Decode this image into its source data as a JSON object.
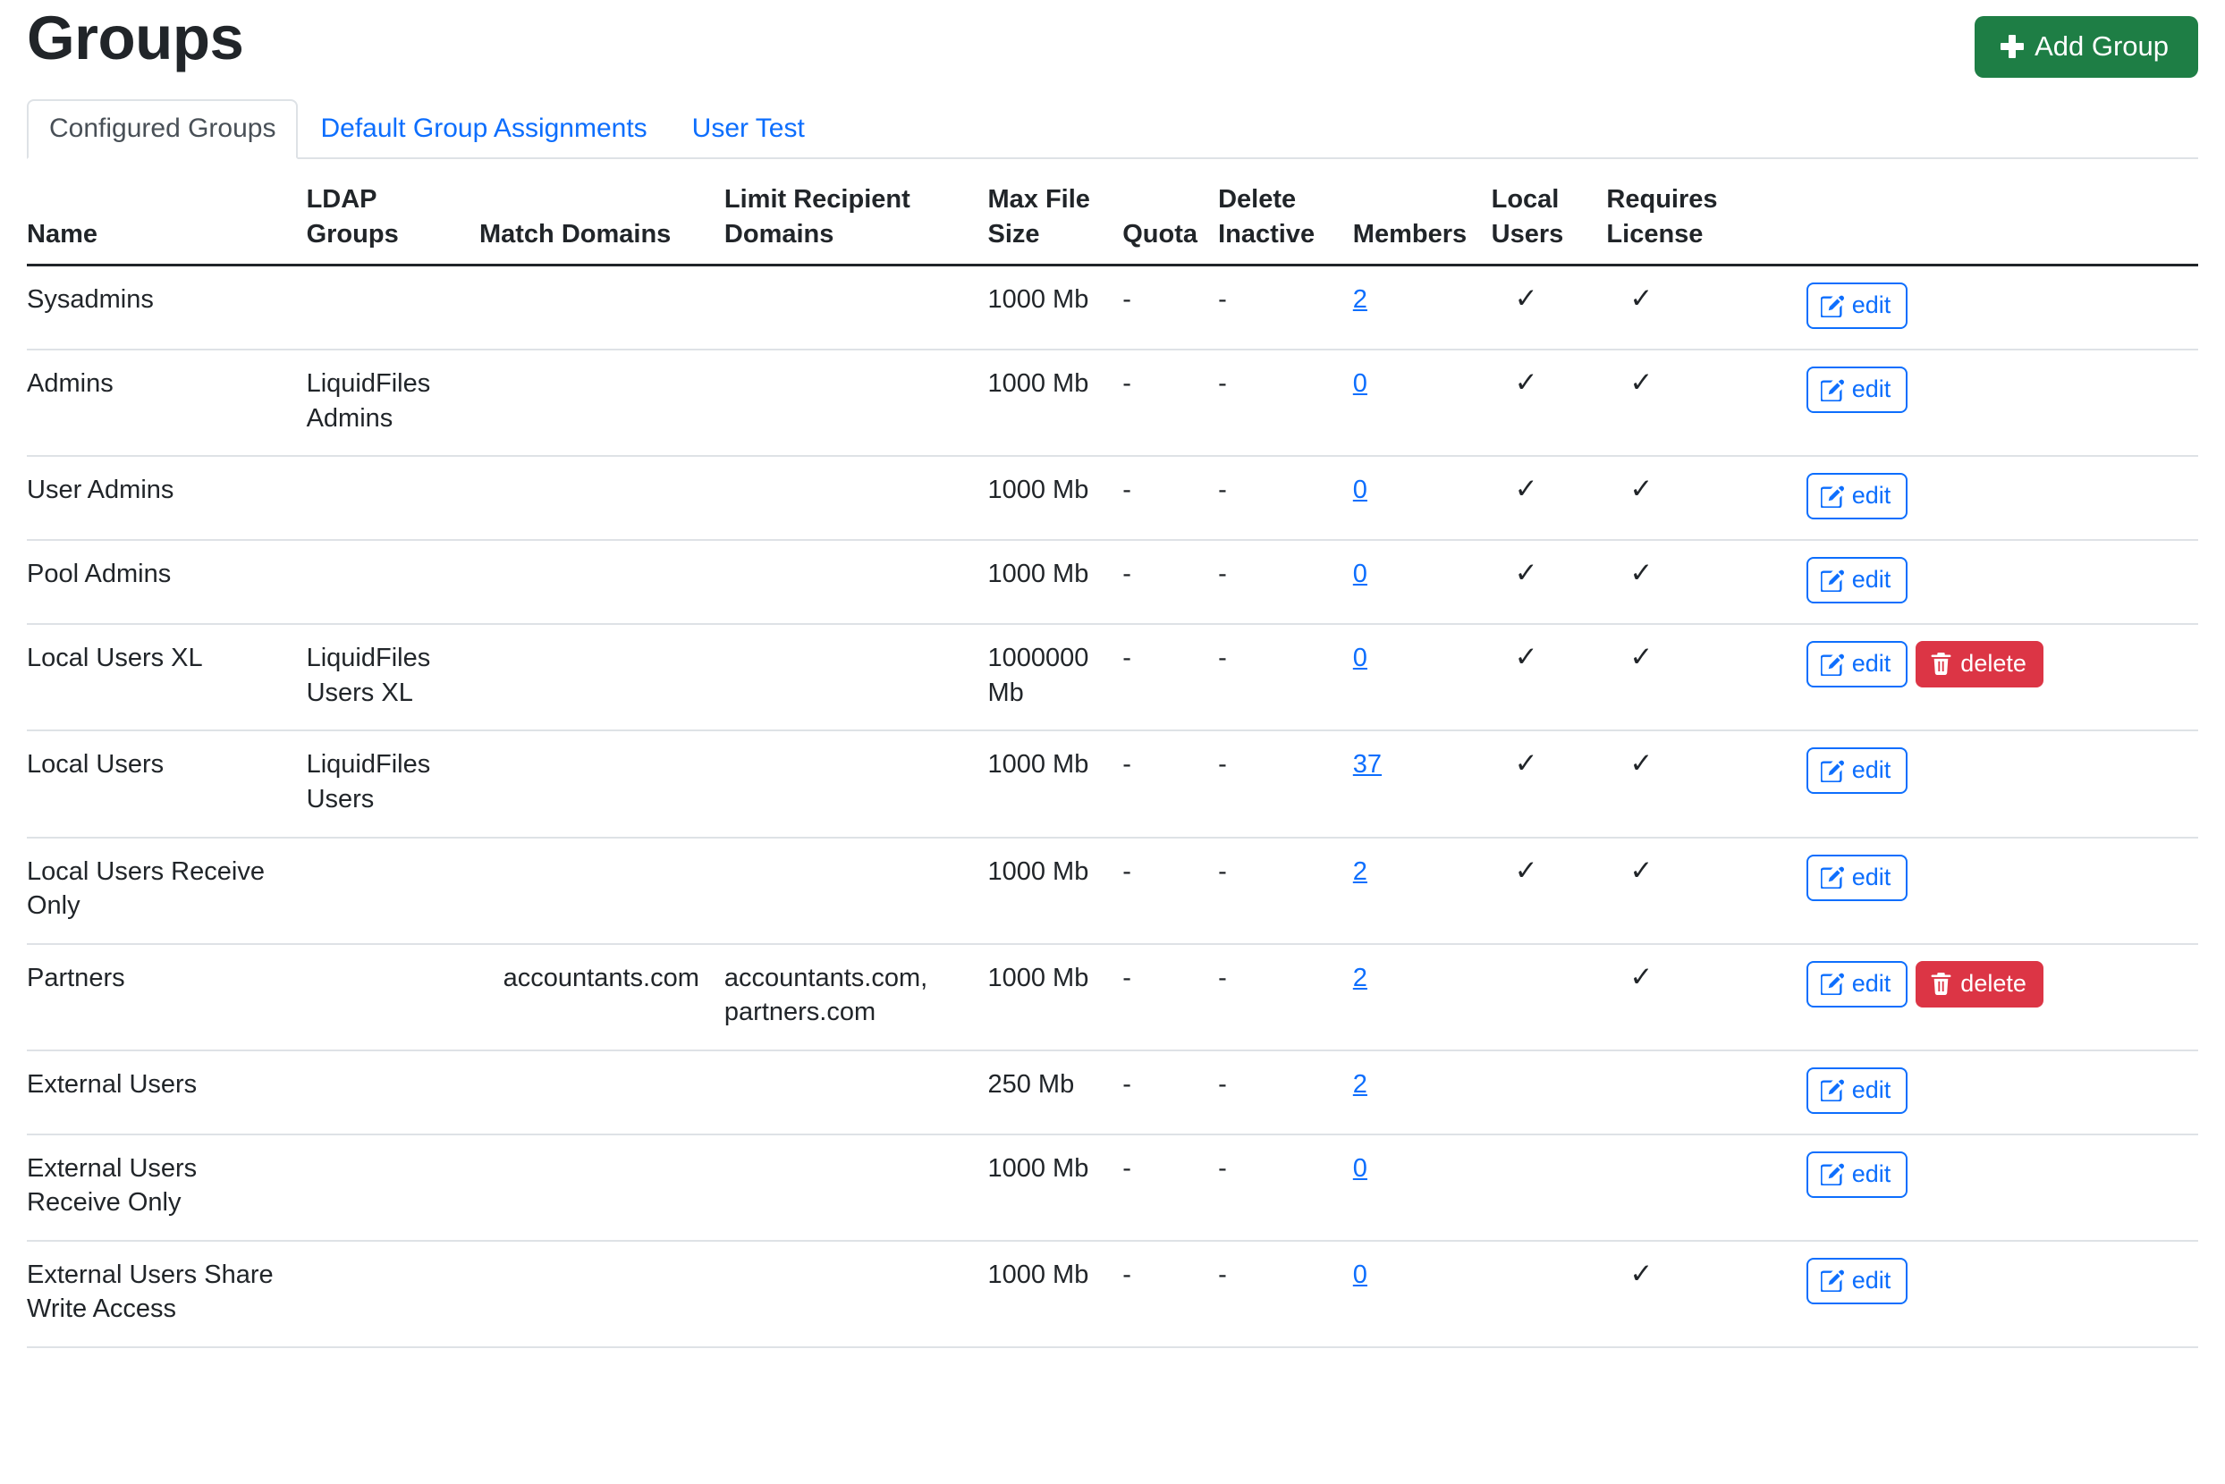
{
  "header": {
    "title": "Groups",
    "add_button": {
      "label": "Add Group",
      "icon": "plus-icon",
      "color": "#1e7e45"
    }
  },
  "tabs": [
    {
      "label": "Configured Groups",
      "active": true
    },
    {
      "label": "Default Group Assignments",
      "active": false
    },
    {
      "label": "User Test",
      "active": false
    }
  ],
  "table": {
    "columns": [
      "Name",
      "LDAP Groups",
      "Match Domains",
      "Limit Recipient Domains",
      "Max File Size",
      "Quota",
      "Delete Inactive",
      "Members",
      "Local Users",
      "Requires License",
      ""
    ],
    "actions": {
      "edit_label": "edit",
      "delete_label": "delete",
      "edit_icon": "pencil-square-icon",
      "delete_icon": "trash-icon",
      "edit_color": "#0d6efd",
      "delete_color": "#dc3545"
    },
    "check_glyph": "✓",
    "empty_glyph": "-",
    "rows": [
      {
        "name": "Sysadmins",
        "ldap_groups": "",
        "match_domains": "",
        "limit_recipient_domains": "",
        "max_file_size": "1000 Mb",
        "quota": "-",
        "delete_inactive": "-",
        "members": "2",
        "local_users": true,
        "requires_license": true,
        "can_delete": false
      },
      {
        "name": "Admins",
        "ldap_groups": "LiquidFiles Admins",
        "match_domains": "",
        "limit_recipient_domains": "",
        "max_file_size": "1000 Mb",
        "quota": "-",
        "delete_inactive": "-",
        "members": "0",
        "local_users": true,
        "requires_license": true,
        "can_delete": false
      },
      {
        "name": "User Admins",
        "ldap_groups": "",
        "match_domains": "",
        "limit_recipient_domains": "",
        "max_file_size": "1000 Mb",
        "quota": "-",
        "delete_inactive": "-",
        "members": "0",
        "local_users": true,
        "requires_license": true,
        "can_delete": false
      },
      {
        "name": "Pool Admins",
        "ldap_groups": "",
        "match_domains": "",
        "limit_recipient_domains": "",
        "max_file_size": "1000 Mb",
        "quota": "-",
        "delete_inactive": "-",
        "members": "0",
        "local_users": true,
        "requires_license": true,
        "can_delete": false
      },
      {
        "name": "Local Users XL",
        "ldap_groups": "LiquidFiles Users XL",
        "match_domains": "",
        "limit_recipient_domains": "",
        "max_file_size": "1000000 Mb",
        "quota": "-",
        "delete_inactive": "-",
        "members": "0",
        "local_users": true,
        "requires_license": true,
        "can_delete": true
      },
      {
        "name": "Local Users",
        "ldap_groups": "LiquidFiles Users",
        "match_domains": "",
        "limit_recipient_domains": "",
        "max_file_size": "1000 Mb",
        "quota": "-",
        "delete_inactive": "-",
        "members": "37",
        "local_users": true,
        "requires_license": true,
        "can_delete": false
      },
      {
        "name": "Local Users Receive Only",
        "ldap_groups": "",
        "match_domains": "",
        "limit_recipient_domains": "",
        "max_file_size": "1000 Mb",
        "quota": "-",
        "delete_inactive": "-",
        "members": "2",
        "local_users": true,
        "requires_license": true,
        "can_delete": false
      },
      {
        "name": "Partners",
        "ldap_groups": "",
        "match_domains": "accountants.com",
        "limit_recipient_domains": "accountants.com, partners.com",
        "max_file_size": "1000 Mb",
        "quota": "-",
        "delete_inactive": "-",
        "members": "2",
        "local_users": false,
        "requires_license": true,
        "can_delete": true
      },
      {
        "name": "External Users",
        "ldap_groups": "",
        "match_domains": "",
        "limit_recipient_domains": "",
        "max_file_size": "250 Mb",
        "quota": "-",
        "delete_inactive": "-",
        "members": "2",
        "local_users": false,
        "requires_license": false,
        "can_delete": false
      },
      {
        "name": "External Users Receive Only",
        "ldap_groups": "",
        "match_domains": "",
        "limit_recipient_domains": "",
        "max_file_size": "1000 Mb",
        "quota": "-",
        "delete_inactive": "-",
        "members": "0",
        "local_users": false,
        "requires_license": false,
        "can_delete": false
      },
      {
        "name": "External Users Share Write Access",
        "ldap_groups": "",
        "match_domains": "",
        "limit_recipient_domains": "",
        "max_file_size": "1000 Mb",
        "quota": "-",
        "delete_inactive": "-",
        "members": "0",
        "local_users": false,
        "requires_license": true,
        "can_delete": false
      }
    ]
  }
}
